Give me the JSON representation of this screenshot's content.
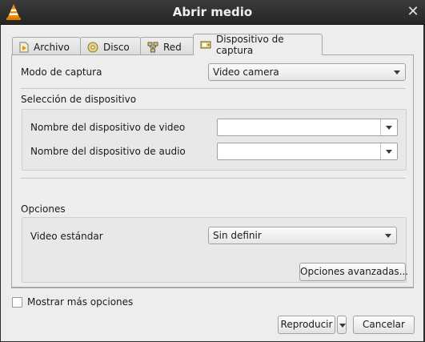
{
  "window": {
    "title": "Abrir medio",
    "close_glyph": "✕"
  },
  "tabs": [
    {
      "label": "Archivo",
      "icon": "file-icon"
    },
    {
      "label": "Disco",
      "icon": "disc-icon"
    },
    {
      "label": "Red",
      "icon": "network-icon"
    },
    {
      "label": "Dispositivo de captura",
      "icon": "capture-device-icon",
      "active": true
    }
  ],
  "capture": {
    "mode_label": "Modo de captura",
    "mode_value": "Video camera",
    "device_section": "Selección de dispositivo",
    "video_device_label": "Nombre del dispositivo de video",
    "video_device_value": "",
    "audio_device_label": "Nombre del dispositivo de audio",
    "audio_device_value": "",
    "options_section": "Opciones",
    "standard_label": "Video estándar",
    "standard_value": "Sin definir",
    "advanced_button": "Opciones avanzadas..."
  },
  "footer": {
    "more_options_label": "Mostrar más opciones",
    "more_options_checked": false,
    "play_button": "Reproducir",
    "cancel_button": "Cancelar"
  },
  "colors": {
    "titlebar": "#2b2b2b",
    "window_bg": "#ededed",
    "vlc_orange": "#f28c00"
  }
}
